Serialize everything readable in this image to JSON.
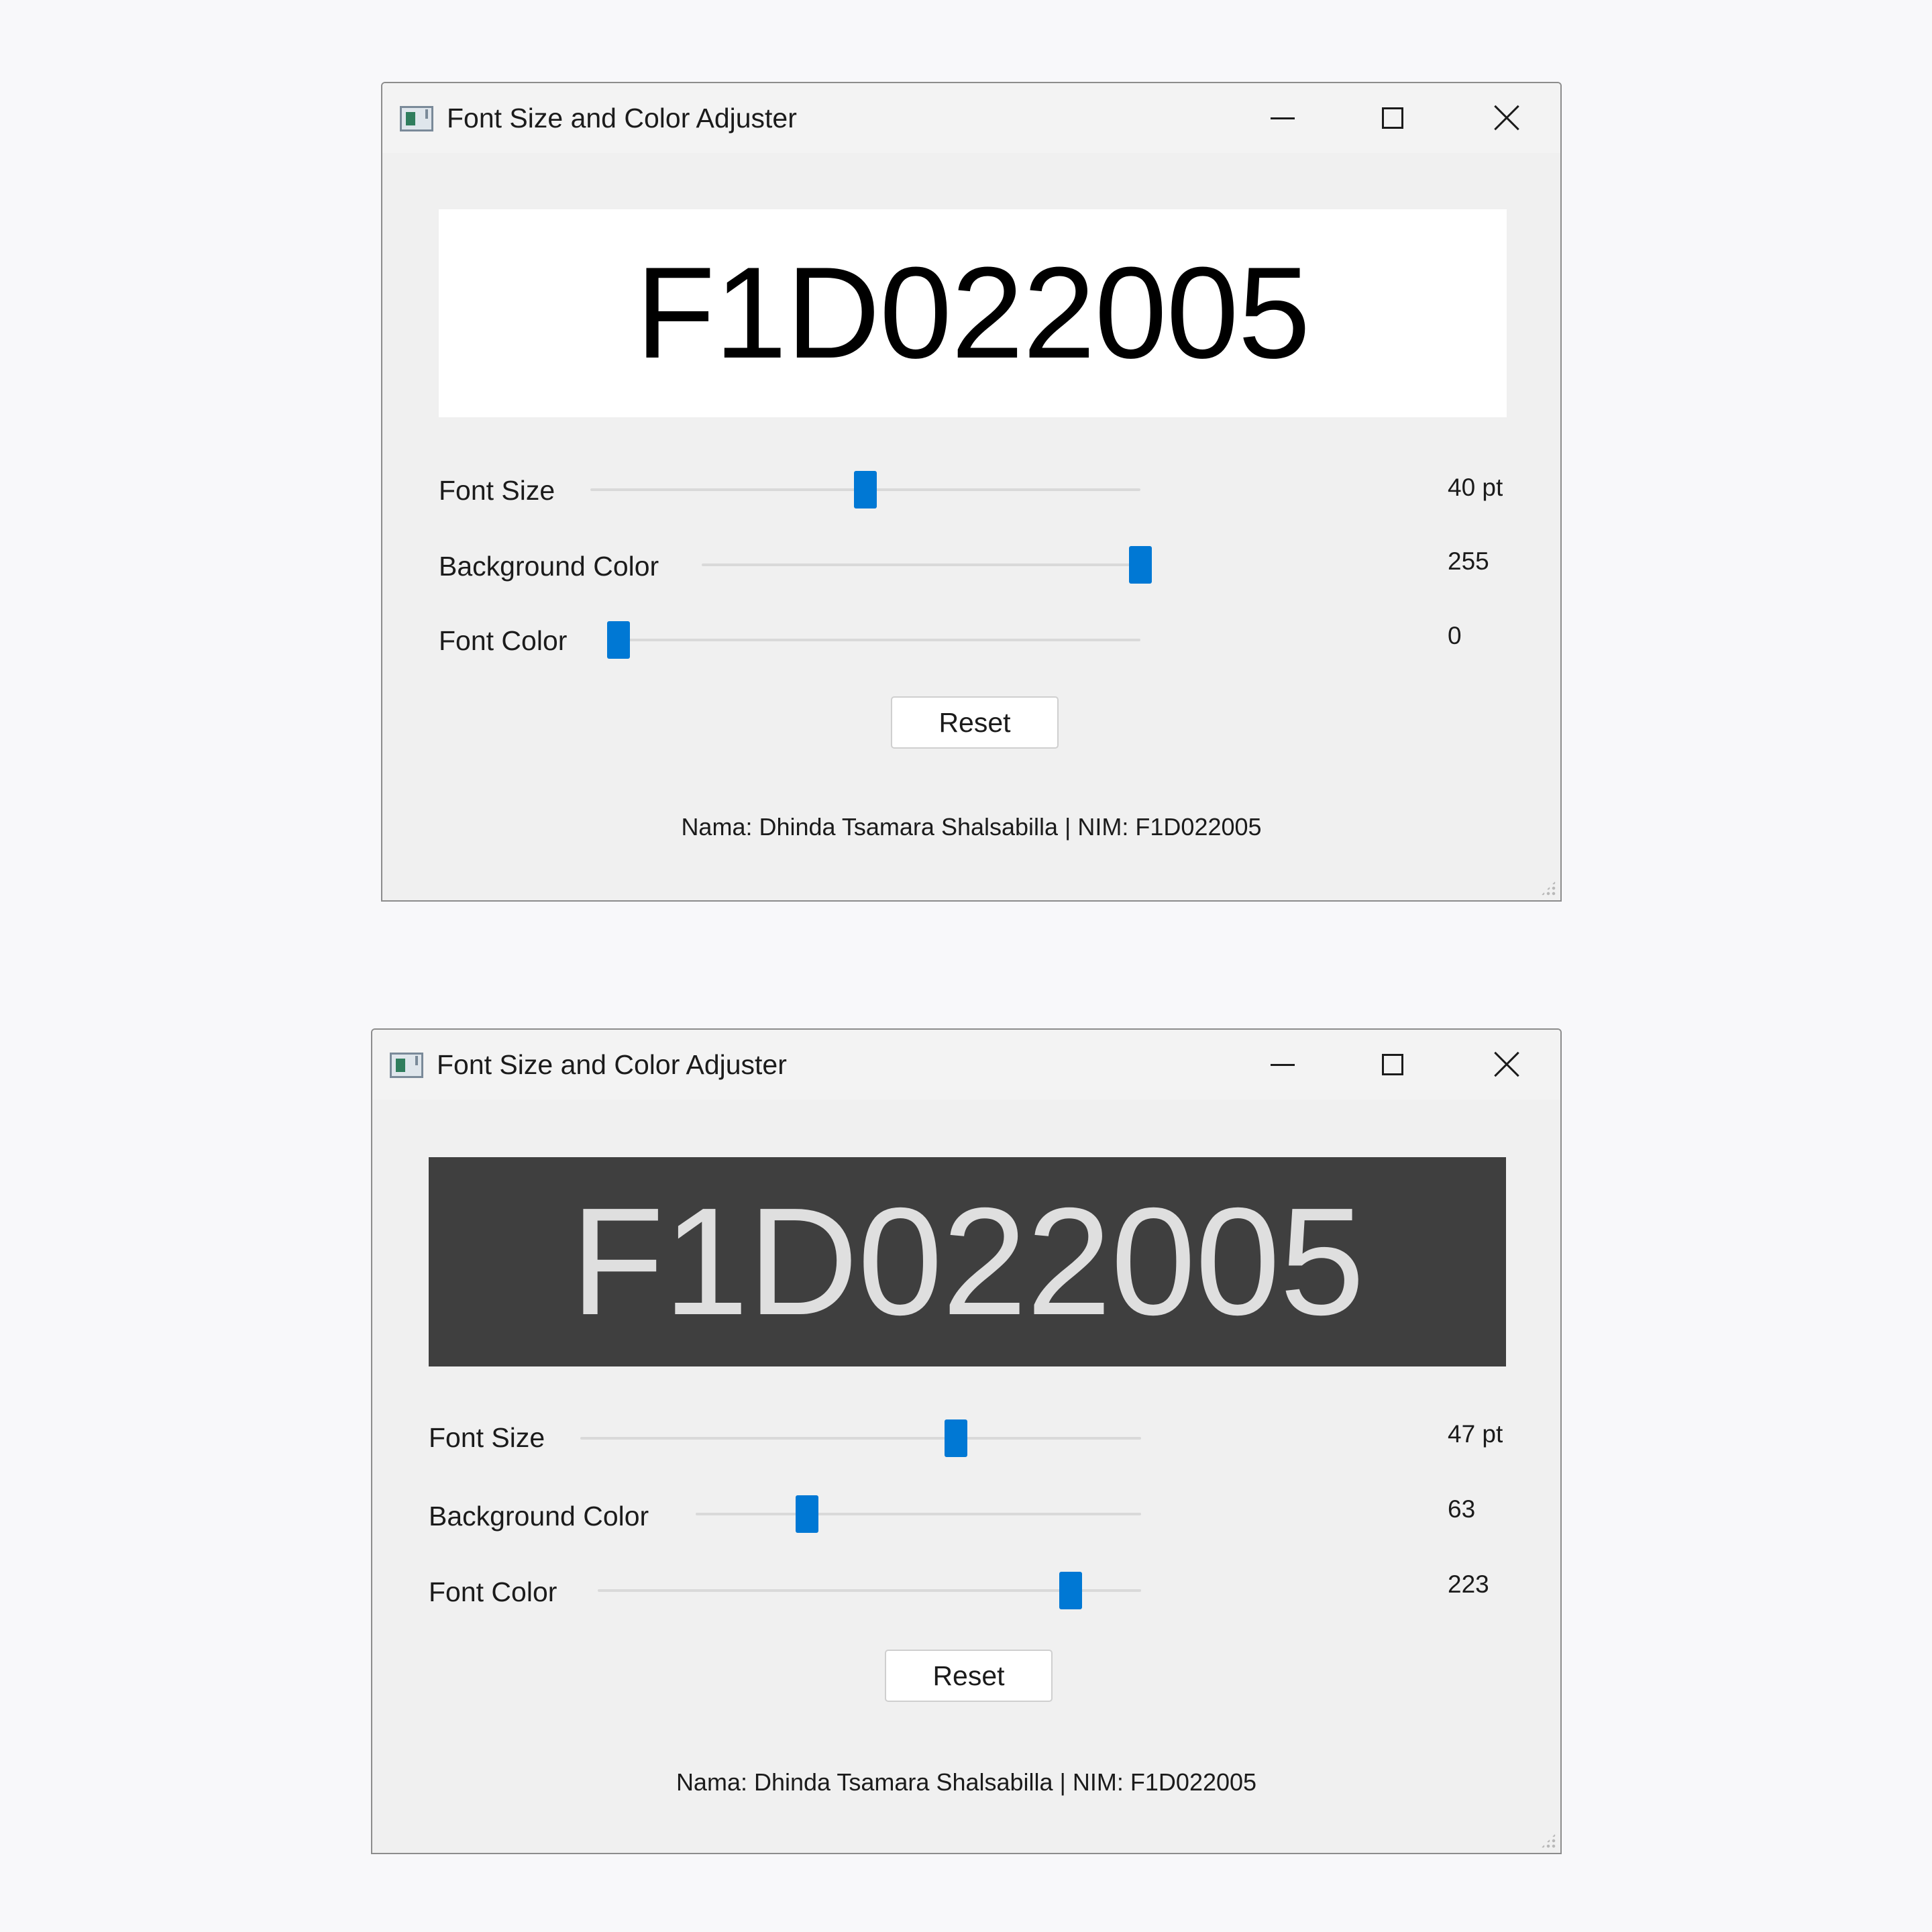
{
  "windows": [
    {
      "title": "Font Size and Color Adjuster",
      "preview_text": "F1D022005",
      "preview_background_color": "#ffffff",
      "preview_text_color": "#000000",
      "sliders": [
        {
          "label": "Font Size",
          "value_text": "40 pt",
          "fraction": 0.5
        },
        {
          "label": "Background Color",
          "value_text": "255",
          "fraction": 1.0
        },
        {
          "label": "Font Color",
          "value_text": "0",
          "fraction": 0.0
        }
      ],
      "reset_label": "Reset",
      "footer": "Nama: Dhinda Tsamara Shalsabilla | NIM: F1D022005"
    },
    {
      "title": "Font Size and Color Adjuster",
      "preview_text": "F1D022005",
      "preview_background_color": "#3f3f3f",
      "preview_text_color": "#dfdfdf",
      "sliders": [
        {
          "label": "Font Size",
          "value_text": "47 pt",
          "fraction": 0.67
        },
        {
          "label": "Background Color",
          "value_text": "63",
          "fraction": 0.25
        },
        {
          "label": "Font Color",
          "value_text": "223",
          "fraction": 0.87
        }
      ],
      "reset_label": "Reset",
      "footer": "Nama: Dhinda Tsamara Shalsabilla | NIM: F1D022005"
    }
  ],
  "theme": {
    "accent": "#0078d4"
  }
}
